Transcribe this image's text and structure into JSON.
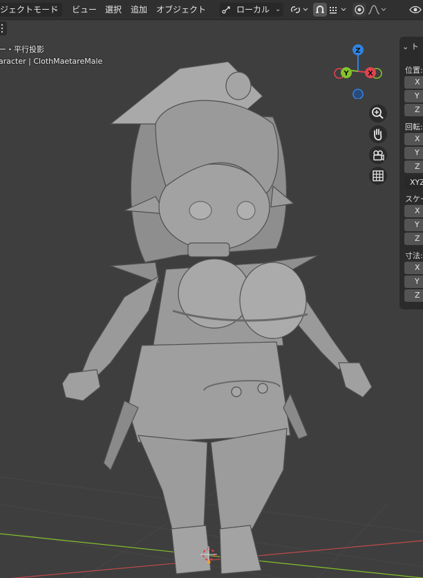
{
  "header": {
    "mode_label": "ジェクトモード",
    "menu_items": [
      "ビュー",
      "選択",
      "追加",
      "オブジェクト"
    ],
    "transform_orientation": "ローカル"
  },
  "viewport": {
    "view_label": "ー・平行投影",
    "object_label": "aracter | ClothMaetareMale"
  },
  "gizmo": {
    "z_label": "Z",
    "y_label": "Y",
    "x_label": "X"
  },
  "sidebar": {
    "section_title": "ト",
    "location_label": "位置:",
    "rotation_label": "回転:",
    "rotation_mode": "XYZ",
    "scale_label": "スケー",
    "dimensions_label": "寸法:",
    "axes": [
      "X",
      "Y",
      "Z"
    ]
  },
  "colors": {
    "header_bg": "#303030",
    "viewport_bg": "#3e3e3e",
    "axis_x": "#e0444f",
    "axis_y": "#84c22c",
    "axis_z": "#2f83e0"
  }
}
